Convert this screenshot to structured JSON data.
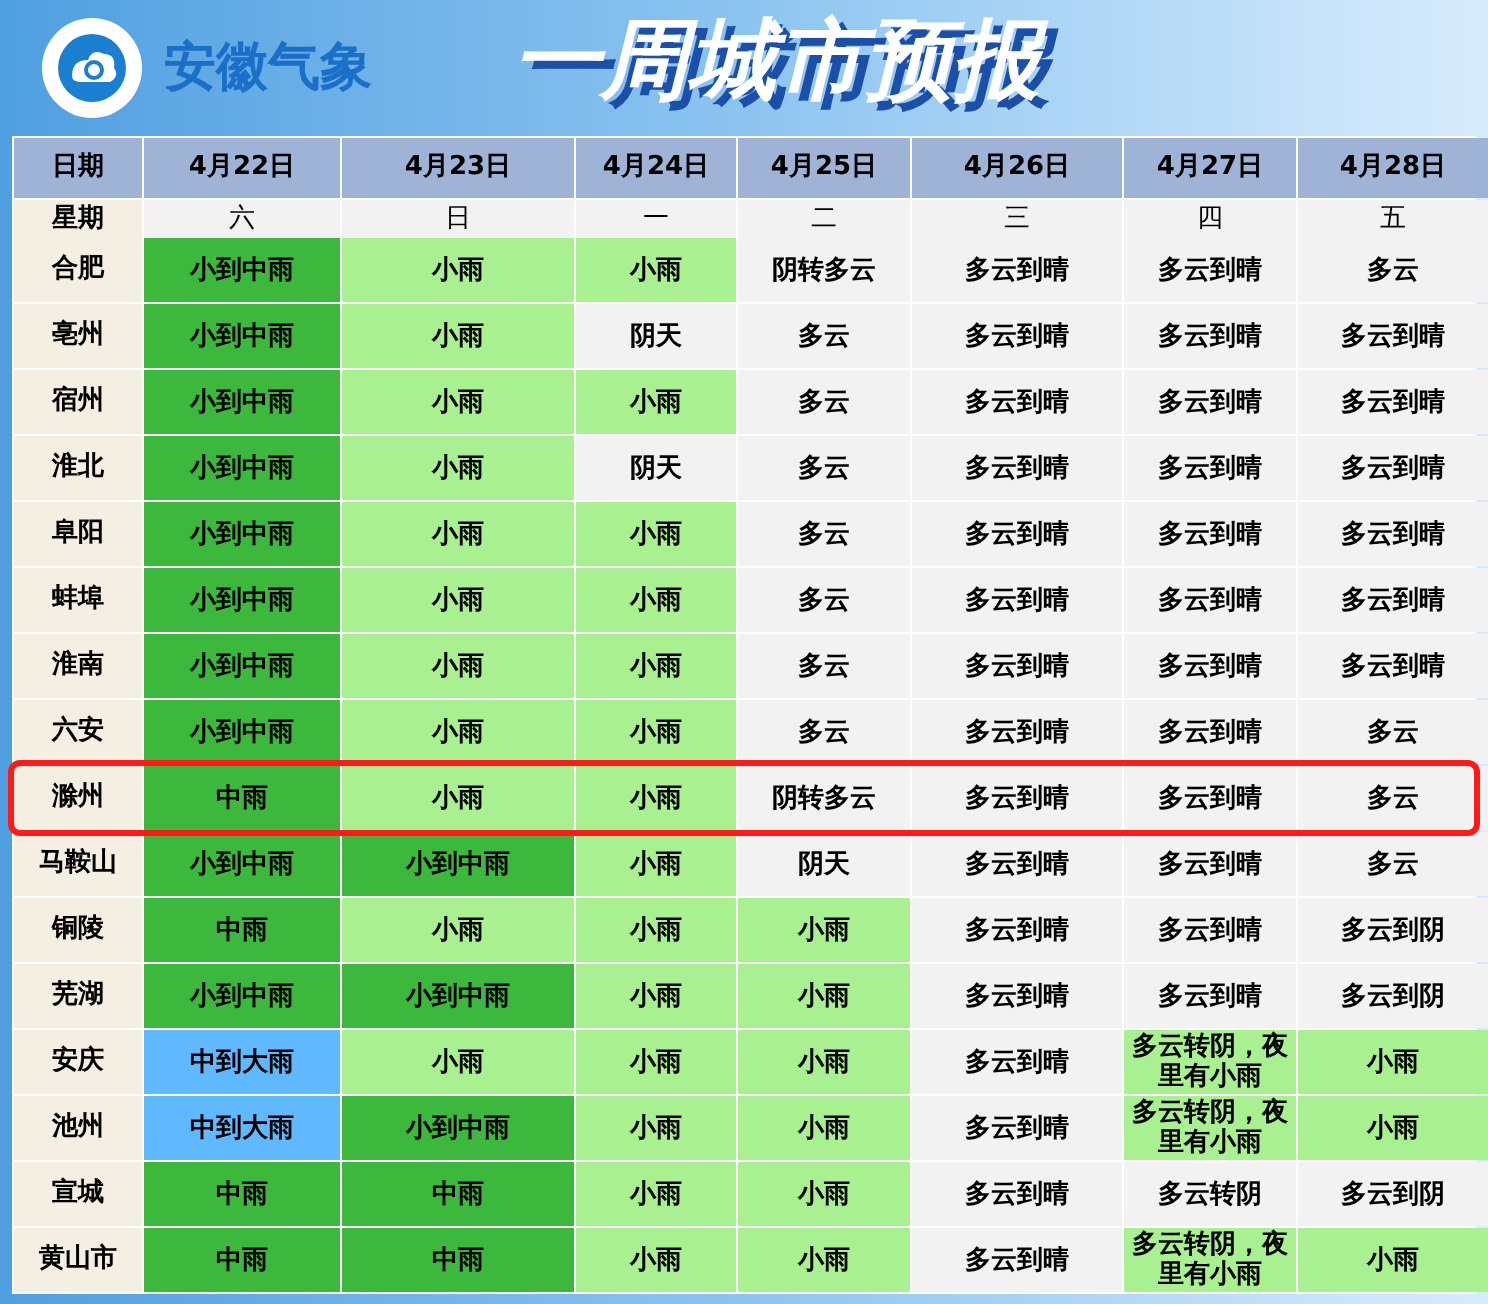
{
  "header": {
    "org_name": "安徽气象",
    "title": "一周城市预报"
  },
  "table": {
    "date_label": "日期",
    "weekday_label": "星期",
    "dates": [
      "4月22日",
      "4月23日",
      "4月24日",
      "4月25日",
      "4月26日",
      "4月27日",
      "4月28日"
    ],
    "weekdays": [
      "六",
      "日",
      "一",
      "二",
      "三",
      "四",
      "五"
    ],
    "rows": [
      {
        "city": "合肥",
        "selected": false,
        "cells": [
          {
            "text": "小到中雨",
            "color": "#3cb93c"
          },
          {
            "text": "小雨",
            "color": "#a8f090"
          },
          {
            "text": "小雨",
            "color": "#a8f090"
          },
          {
            "text": "阴转多云",
            "color": "#f2f2f2"
          },
          {
            "text": "多云到晴",
            "color": "#f2f2f2"
          },
          {
            "text": "多云到晴",
            "color": "#f2f2f2"
          },
          {
            "text": "多云",
            "color": "#f2f2f2"
          }
        ]
      },
      {
        "city": "亳州",
        "selected": false,
        "cells": [
          {
            "text": "小到中雨",
            "color": "#3cb93c"
          },
          {
            "text": "小雨",
            "color": "#a8f090"
          },
          {
            "text": "阴天",
            "color": "#f2f2f2"
          },
          {
            "text": "多云",
            "color": "#f2f2f2"
          },
          {
            "text": "多云到晴",
            "color": "#f2f2f2"
          },
          {
            "text": "多云到晴",
            "color": "#f2f2f2"
          },
          {
            "text": "多云到晴",
            "color": "#f2f2f2"
          }
        ]
      },
      {
        "city": "宿州",
        "selected": false,
        "cells": [
          {
            "text": "小到中雨",
            "color": "#3cb93c"
          },
          {
            "text": "小雨",
            "color": "#a8f090"
          },
          {
            "text": "小雨",
            "color": "#a8f090"
          },
          {
            "text": "多云",
            "color": "#f2f2f2"
          },
          {
            "text": "多云到晴",
            "color": "#f2f2f2"
          },
          {
            "text": "多云到晴",
            "color": "#f2f2f2"
          },
          {
            "text": "多云到晴",
            "color": "#f2f2f2"
          }
        ]
      },
      {
        "city": "淮北",
        "selected": false,
        "cells": [
          {
            "text": "小到中雨",
            "color": "#3cb93c"
          },
          {
            "text": "小雨",
            "color": "#a8f090"
          },
          {
            "text": "阴天",
            "color": "#f2f2f2"
          },
          {
            "text": "多云",
            "color": "#f2f2f2"
          },
          {
            "text": "多云到晴",
            "color": "#f2f2f2"
          },
          {
            "text": "多云到晴",
            "color": "#f2f2f2"
          },
          {
            "text": "多云到晴",
            "color": "#f2f2f2"
          }
        ]
      },
      {
        "city": "阜阳",
        "selected": false,
        "cells": [
          {
            "text": "小到中雨",
            "color": "#3cb93c"
          },
          {
            "text": "小雨",
            "color": "#a8f090"
          },
          {
            "text": "小雨",
            "color": "#a8f090"
          },
          {
            "text": "多云",
            "color": "#f2f2f2"
          },
          {
            "text": "多云到晴",
            "color": "#f2f2f2"
          },
          {
            "text": "多云到晴",
            "color": "#f2f2f2"
          },
          {
            "text": "多云到晴",
            "color": "#f2f2f2"
          }
        ]
      },
      {
        "city": "蚌埠",
        "selected": false,
        "cells": [
          {
            "text": "小到中雨",
            "color": "#3cb93c"
          },
          {
            "text": "小雨",
            "color": "#a8f090"
          },
          {
            "text": "小雨",
            "color": "#a8f090"
          },
          {
            "text": "多云",
            "color": "#f2f2f2"
          },
          {
            "text": "多云到晴",
            "color": "#f2f2f2"
          },
          {
            "text": "多云到晴",
            "color": "#f2f2f2"
          },
          {
            "text": "多云到晴",
            "color": "#f2f2f2"
          }
        ]
      },
      {
        "city": "淮南",
        "selected": false,
        "cells": [
          {
            "text": "小到中雨",
            "color": "#3cb93c"
          },
          {
            "text": "小雨",
            "color": "#a8f090"
          },
          {
            "text": "小雨",
            "color": "#a8f090"
          },
          {
            "text": "多云",
            "color": "#f2f2f2"
          },
          {
            "text": "多云到晴",
            "color": "#f2f2f2"
          },
          {
            "text": "多云到晴",
            "color": "#f2f2f2"
          },
          {
            "text": "多云到晴",
            "color": "#f2f2f2"
          }
        ]
      },
      {
        "city": "六安",
        "selected": false,
        "cells": [
          {
            "text": "小到中雨",
            "color": "#3cb93c"
          },
          {
            "text": "小雨",
            "color": "#a8f090"
          },
          {
            "text": "小雨",
            "color": "#a8f090"
          },
          {
            "text": "多云",
            "color": "#f2f2f2"
          },
          {
            "text": "多云到晴",
            "color": "#f2f2f2"
          },
          {
            "text": "多云到晴",
            "color": "#f2f2f2"
          },
          {
            "text": "多云",
            "color": "#f2f2f2"
          }
        ]
      },
      {
        "city": "滁州",
        "selected": true,
        "cells": [
          {
            "text": "中雨",
            "color": "#3cb93c"
          },
          {
            "text": "小雨",
            "color": "#a8f090"
          },
          {
            "text": "小雨",
            "color": "#a8f090"
          },
          {
            "text": "阴转多云",
            "color": "#f2f2f2"
          },
          {
            "text": "多云到晴",
            "color": "#f2f2f2"
          },
          {
            "text": "多云到晴",
            "color": "#f2f2f2"
          },
          {
            "text": "多云",
            "color": "#f2f2f2"
          }
        ]
      },
      {
        "city": "马鞍山",
        "selected": false,
        "cells": [
          {
            "text": "小到中雨",
            "color": "#3cb93c"
          },
          {
            "text": "小到中雨",
            "color": "#3cb93c"
          },
          {
            "text": "小雨",
            "color": "#a8f090"
          },
          {
            "text": "阴天",
            "color": "#f2f2f2"
          },
          {
            "text": "多云到晴",
            "color": "#f2f2f2"
          },
          {
            "text": "多云到晴",
            "color": "#f2f2f2"
          },
          {
            "text": "多云",
            "color": "#f2f2f2"
          }
        ]
      },
      {
        "city": "铜陵",
        "selected": false,
        "cells": [
          {
            "text": "中雨",
            "color": "#3cb93c"
          },
          {
            "text": "小雨",
            "color": "#a8f090"
          },
          {
            "text": "小雨",
            "color": "#a8f090"
          },
          {
            "text": "小雨",
            "color": "#a8f090"
          },
          {
            "text": "多云到晴",
            "color": "#f2f2f2"
          },
          {
            "text": "多云到晴",
            "color": "#f2f2f2"
          },
          {
            "text": "多云到阴",
            "color": "#f2f2f2"
          }
        ]
      },
      {
        "city": "芜湖",
        "selected": false,
        "cells": [
          {
            "text": "小到中雨",
            "color": "#3cb93c"
          },
          {
            "text": "小到中雨",
            "color": "#3cb93c"
          },
          {
            "text": "小雨",
            "color": "#a8f090"
          },
          {
            "text": "小雨",
            "color": "#a8f090"
          },
          {
            "text": "多云到晴",
            "color": "#f2f2f2"
          },
          {
            "text": "多云到晴",
            "color": "#f2f2f2"
          },
          {
            "text": "多云到阴",
            "color": "#f2f2f2"
          }
        ]
      },
      {
        "city": "安庆",
        "selected": false,
        "cells": [
          {
            "text": "中到大雨",
            "color": "#60b8ff"
          },
          {
            "text": "小雨",
            "color": "#a8f090"
          },
          {
            "text": "小雨",
            "color": "#a8f090"
          },
          {
            "text": "小雨",
            "color": "#a8f090"
          },
          {
            "text": "多云到晴",
            "color": "#f2f2f2"
          },
          {
            "text": "多云转阴，夜里有小雨",
            "color": "#a8f090"
          },
          {
            "text": "小雨",
            "color": "#a8f090"
          }
        ]
      },
      {
        "city": "池州",
        "selected": false,
        "cells": [
          {
            "text": "中到大雨",
            "color": "#60b8ff"
          },
          {
            "text": "小到中雨",
            "color": "#3cb93c"
          },
          {
            "text": "小雨",
            "color": "#a8f090"
          },
          {
            "text": "小雨",
            "color": "#a8f090"
          },
          {
            "text": "多云到晴",
            "color": "#f2f2f2"
          },
          {
            "text": "多云转阴，夜里有小雨",
            "color": "#a8f090"
          },
          {
            "text": "小雨",
            "color": "#a8f090"
          }
        ]
      },
      {
        "city": "宣城",
        "selected": false,
        "cells": [
          {
            "text": "中雨",
            "color": "#3cb93c"
          },
          {
            "text": "中雨",
            "color": "#3cb93c"
          },
          {
            "text": "小雨",
            "color": "#a8f090"
          },
          {
            "text": "小雨",
            "color": "#a8f090"
          },
          {
            "text": "多云到晴",
            "color": "#f2f2f2"
          },
          {
            "text": "多云转阴",
            "color": "#f2f2f2"
          },
          {
            "text": "多云到阴",
            "color": "#f2f2f2"
          }
        ]
      },
      {
        "city": "黄山市",
        "selected": false,
        "cells": [
          {
            "text": "中雨",
            "color": "#3cb93c"
          },
          {
            "text": "中雨",
            "color": "#3cb93c"
          },
          {
            "text": "小雨",
            "color": "#a8f090"
          },
          {
            "text": "小雨",
            "color": "#a8f090"
          },
          {
            "text": "多云到晴",
            "color": "#f2f2f2"
          },
          {
            "text": "多云转阴，夜里有小雨",
            "color": "#a8f090"
          },
          {
            "text": "小雨",
            "color": "#a8f090"
          }
        ]
      }
    ]
  }
}
